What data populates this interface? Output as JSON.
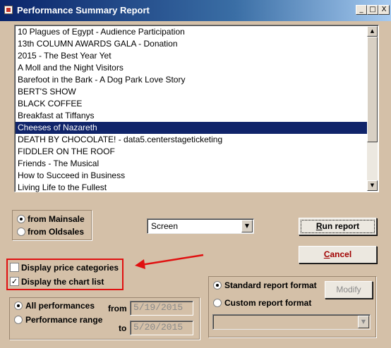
{
  "window": {
    "title": "Performance Summary Report",
    "controls": {
      "minimize": "_",
      "maximize": "□",
      "close": "X"
    }
  },
  "performances": {
    "items": [
      "10 Plagues of Egypt - Audience Participation",
      "13th COLUMN AWARDS GALA - Donation",
      "2015 - The Best Year Yet",
      "A Moll and the Night Visitors",
      "Barefoot in the Bark - A Dog Park Love Story",
      "BERT'S SHOW",
      "BLACK COFFEE",
      "Breakfast at Tiffanys",
      "Cheeses of Nazareth",
      "DEATH BY CHOCOLATE! - data5.centerstageticketing",
      "FIDDLER ON THE ROOF",
      "Friends - The Musical",
      "How to Succeed in Business",
      "Living Life to the Fullest"
    ],
    "selected_index": 8
  },
  "source": {
    "mainsale": "from Mainsale",
    "oldsales": "from Oldsales",
    "selected": "mainsale"
  },
  "output": {
    "value": "Screen"
  },
  "buttons": {
    "run_first": "R",
    "run_rest": "un report",
    "cancel_first": "C",
    "cancel_rest": "ancel",
    "modify": "Modify"
  },
  "options": {
    "display_price_categories": {
      "label": "Display price categories",
      "checked": false
    },
    "display_chart_list": {
      "label": "Display the chart list",
      "checked": true
    }
  },
  "range": {
    "all": "All performances",
    "range": "Performance range",
    "selected": "all",
    "from_label": "from",
    "to_label": "to",
    "from_date": "5/19/2015",
    "to_date": "5/20/2015"
  },
  "format": {
    "standard": "Standard report format",
    "custom": "Custom report format",
    "selected": "standard",
    "custom_value": ""
  },
  "colors": {
    "background": "#d4c0a8",
    "selection": "#10246a",
    "annotation": "#e01010"
  }
}
